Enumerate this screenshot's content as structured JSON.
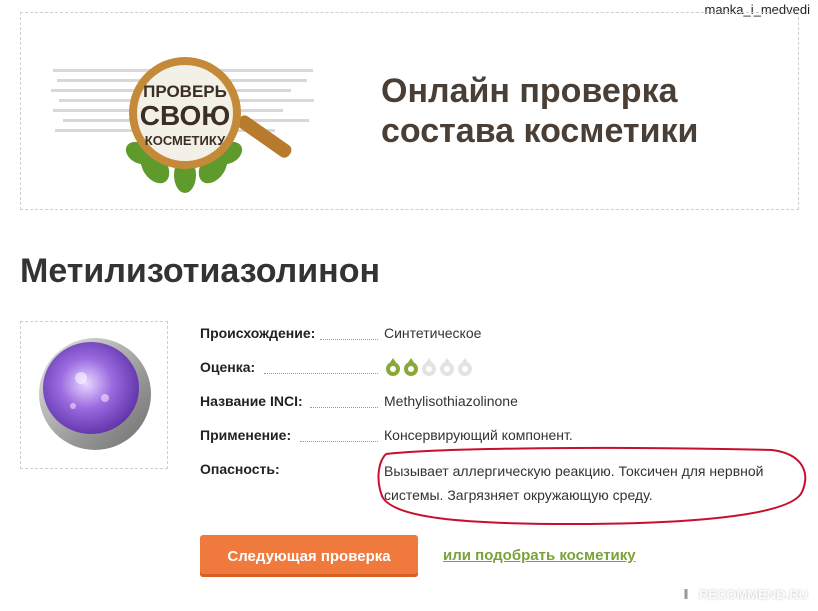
{
  "watermark_user": "manka_i_medvedi",
  "banner": {
    "logo_lines": [
      "ПРОВЕРЬ",
      "СВОЮ",
      "КОСМЕТИКУ"
    ],
    "title_line1": "Онлайн проверка",
    "title_line2": "состава косметики"
  },
  "product": {
    "title": "Метилизотиазолинон",
    "image_icon": "purple-chemical-dish"
  },
  "properties": [
    {
      "label": "Происхождение:",
      "value": "Синтетическое"
    },
    {
      "label": "Оценка:",
      "rating_filled": 2,
      "rating_max": 5
    },
    {
      "label": "Название INCI:",
      "value": "Methylisothiazolinone"
    },
    {
      "label": "Применение:",
      "value": "Консервирующий компонент."
    },
    {
      "label": "Опасность:",
      "value": "Вызывает аллергическую реакцию. Токсичен для нервной системы. Загрязняет окружающую среду."
    }
  ],
  "actions": {
    "next_button": "Следующая проверка",
    "pick_link": "или подобрать косметику"
  },
  "watermark_site": "RECOMMEND.RU",
  "colors": {
    "accent_orange": "#f07a3d",
    "link_green": "#7aa23a",
    "rating_green": "#8aa83a",
    "annotation_red": "#c8102e"
  }
}
